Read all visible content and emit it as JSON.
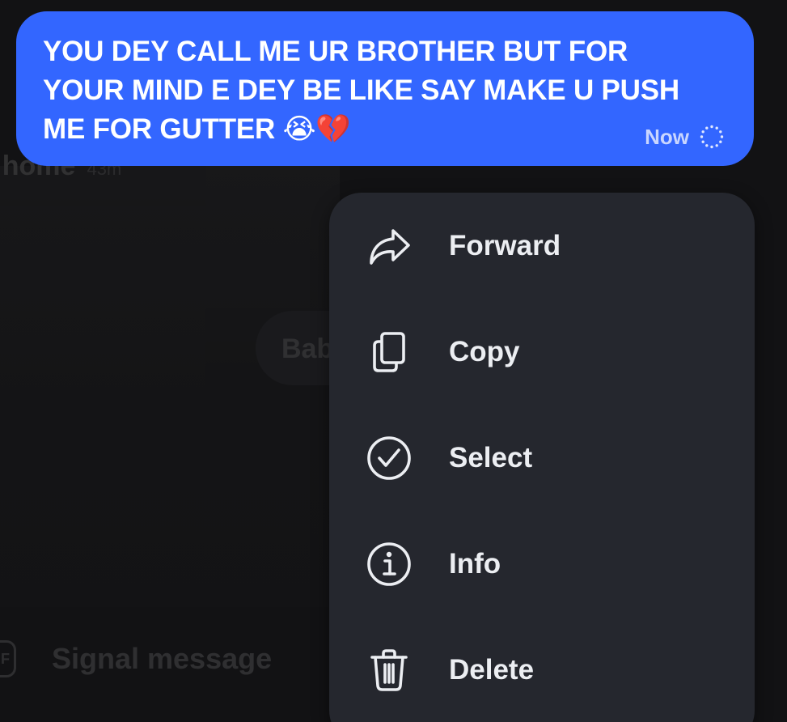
{
  "background": {
    "caption_text": "t home",
    "caption_time": "43m",
    "chip_text": "Bab",
    "composer_gif_label": "GIF",
    "composer_placeholder": "Signal message"
  },
  "message": {
    "text": "YOU DEY CALL ME UR BROTHER BUT FOR YOUR MIND E DEY BE LIKE SAY MAKE U PUSH ME FOR GUTTER 😭💔",
    "time": "Now",
    "status_icon": "sending-spinner-icon",
    "bubble_color": "#3366ff"
  },
  "context_menu": {
    "background_color": "#25272e",
    "items": [
      {
        "label": "Forward",
        "icon": "forward-icon"
      },
      {
        "label": "Copy",
        "icon": "copy-icon"
      },
      {
        "label": "Select",
        "icon": "select-check-icon"
      },
      {
        "label": "Info",
        "icon": "info-icon"
      },
      {
        "label": "Delete",
        "icon": "trash-icon"
      }
    ]
  }
}
